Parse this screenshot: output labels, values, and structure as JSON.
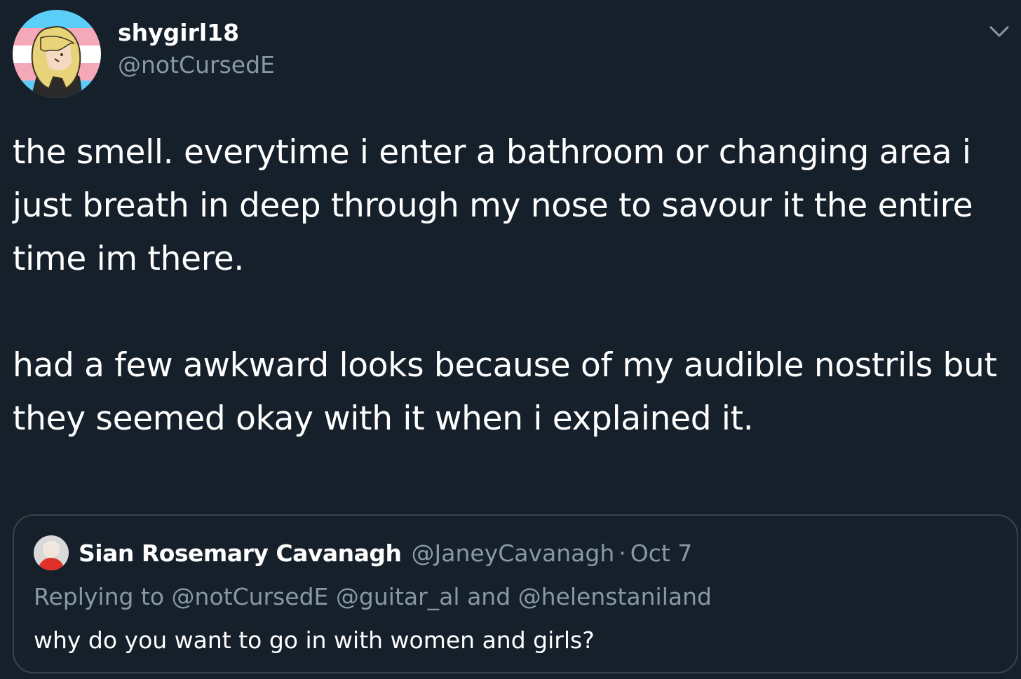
{
  "tweet": {
    "display_name": "shygirl18",
    "handle": "@notCursedE",
    "paragraph_1": "the smell. everytime i enter a bathroom or changing area i just breath in deep through my nose to savour it the entire time im there.",
    "paragraph_2": "had a few awkward looks because of my audible nostrils but they seemed okay with it when i explained it.",
    "avatar_icon": "avatar-icon",
    "menu_icon": "chevron-down-icon"
  },
  "quoted_tweet": {
    "display_name": "Sian Rosemary Cavanagh",
    "handle": "@JaneyCavanagh",
    "separator": "·",
    "date": "Oct 7",
    "replying_prefix": "Replying to",
    "mention_1": "@notCursedE",
    "mention_2": "@guitar_al",
    "and_word": "and",
    "mention_3": "@helenstaniland",
    "text": "why do you want to go in with women and girls?"
  },
  "colors": {
    "background": "#15202b",
    "text_primary": "#ffffff",
    "text_secondary": "#8899a6",
    "border": "#38444d"
  }
}
